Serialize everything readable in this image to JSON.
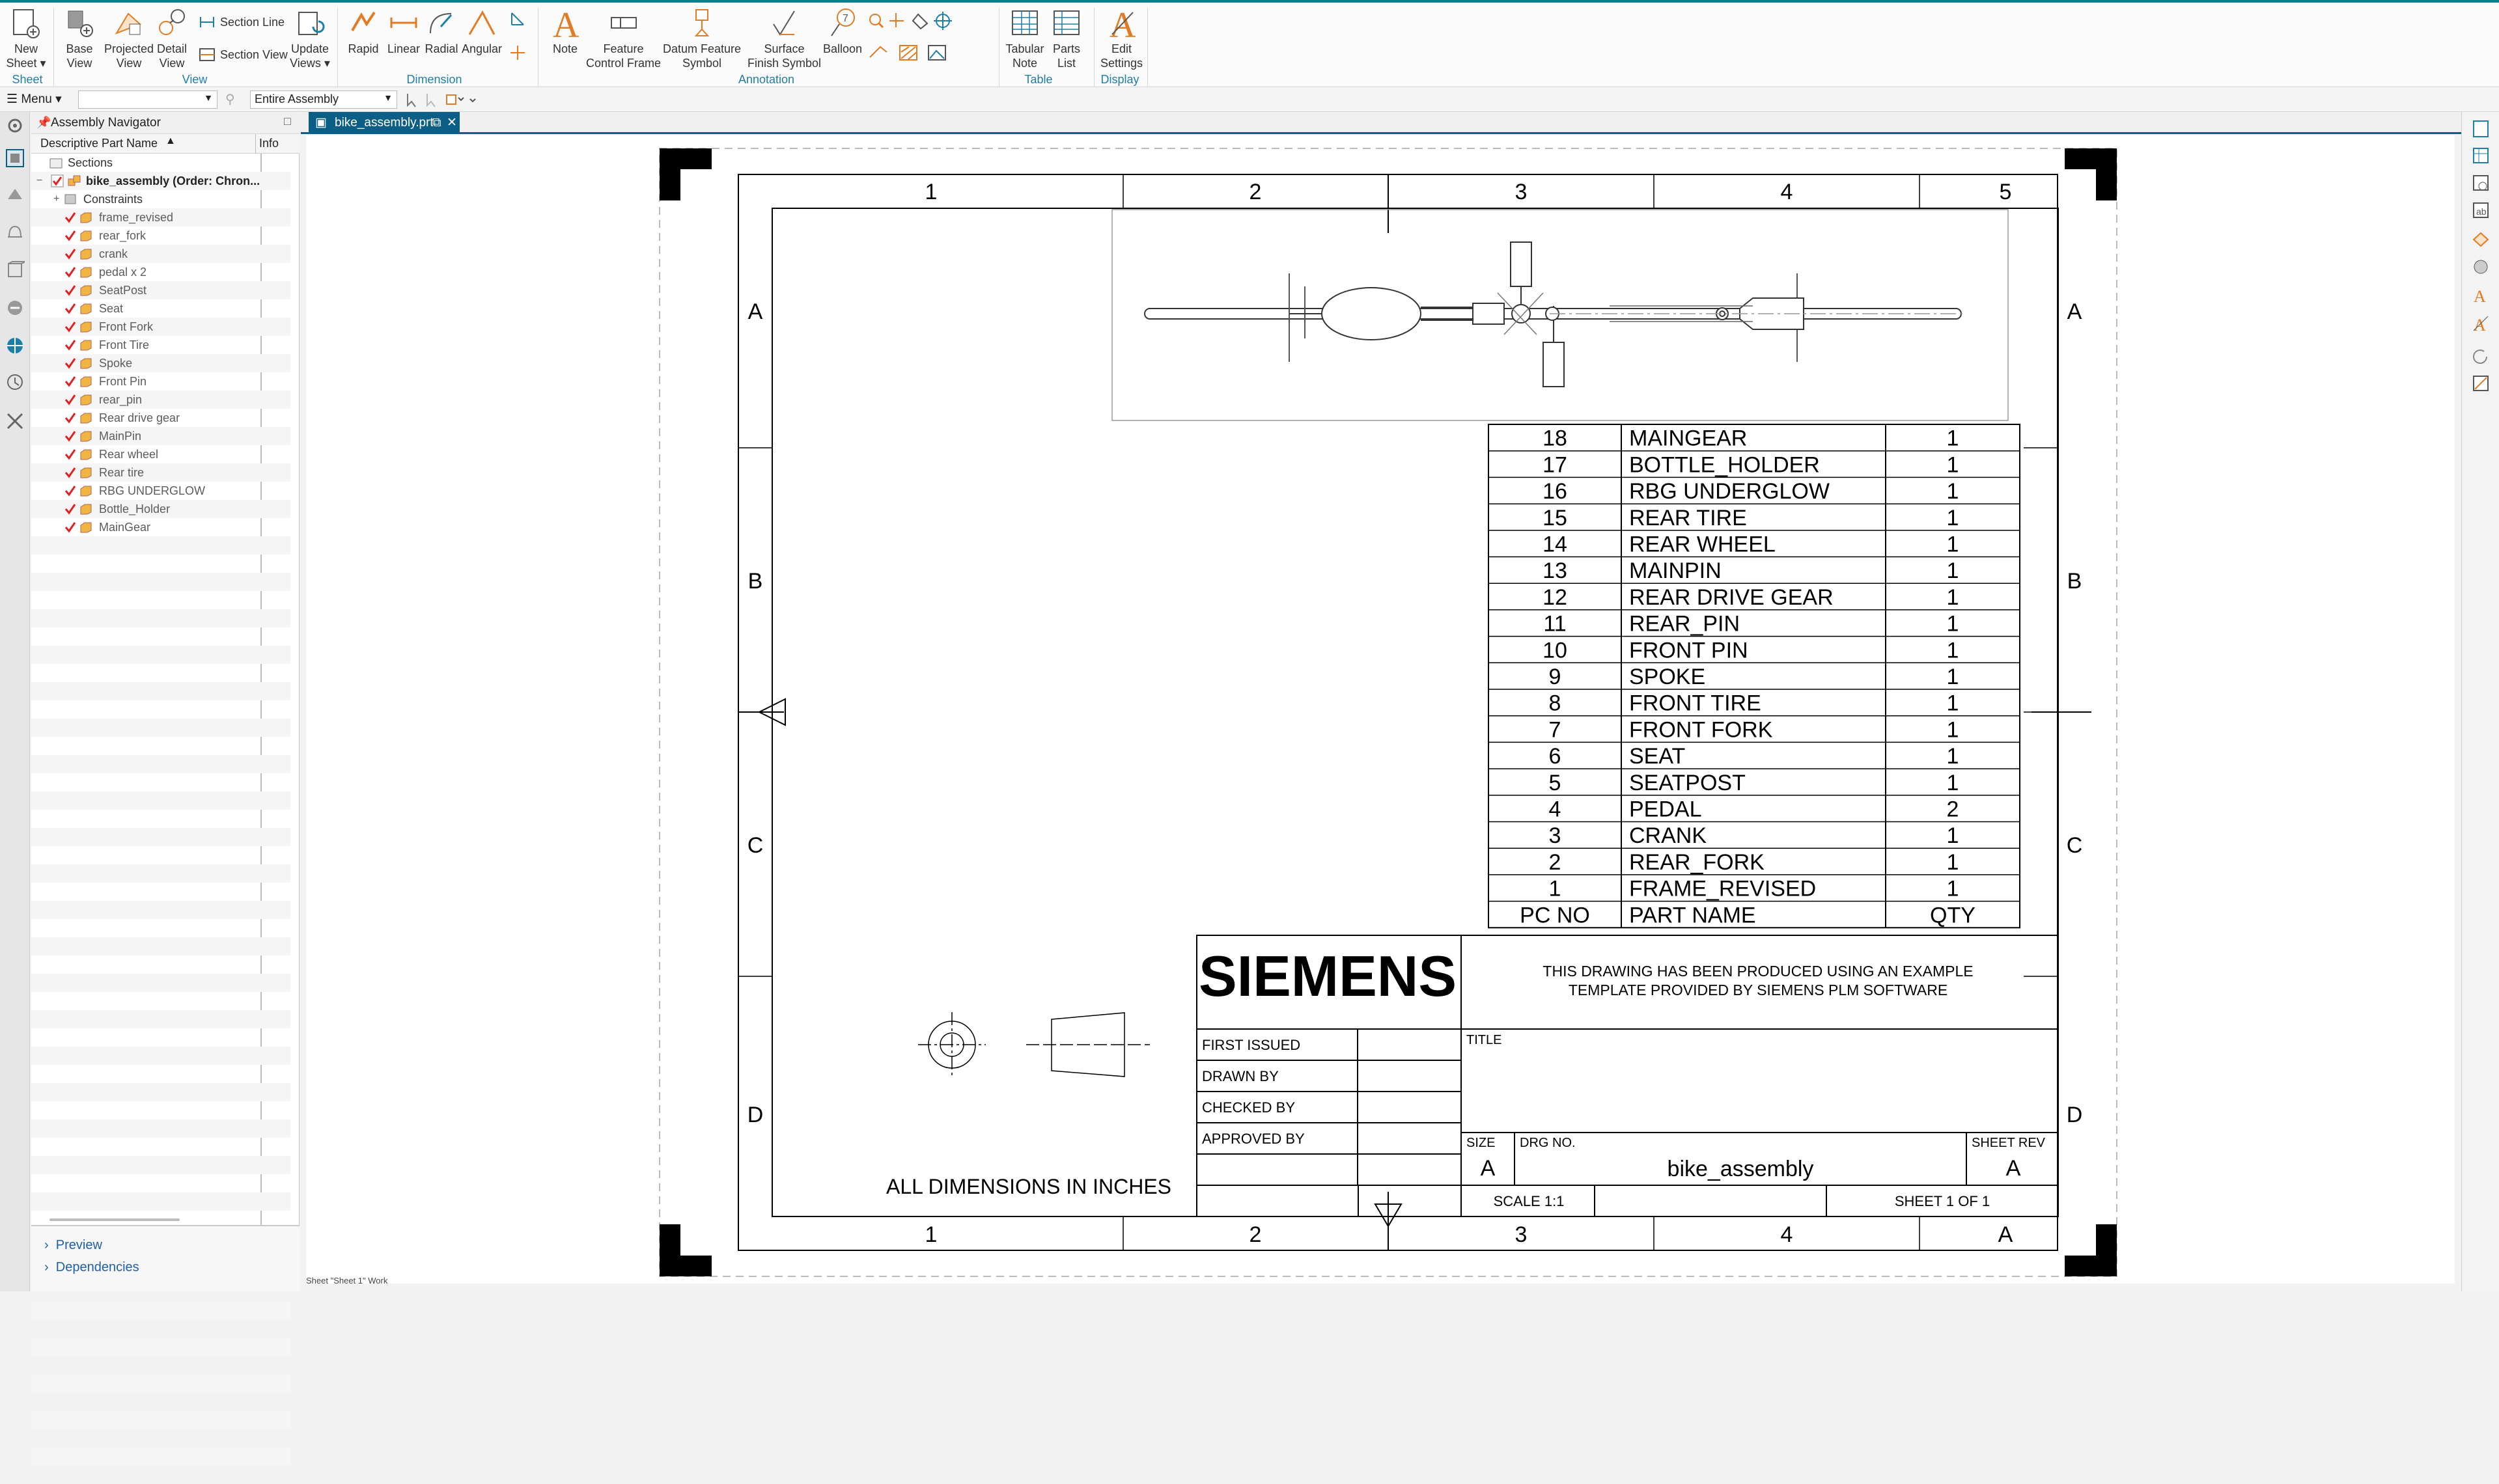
{
  "ribbon": {
    "buttons": [
      {
        "key": "new_sheet",
        "label": "New\nSheet ▾"
      },
      {
        "key": "base_view",
        "label": "Base\nView"
      },
      {
        "key": "projected_view",
        "label": "Projected\nView"
      },
      {
        "key": "detail_view",
        "label": "Detail\nView"
      },
      {
        "key": "update_views",
        "label": "Update\nViews ▾"
      },
      {
        "key": "rapid",
        "label": "Rapid"
      },
      {
        "key": "linear",
        "label": "Linear"
      },
      {
        "key": "radial",
        "label": "Radial"
      },
      {
        "key": "angular",
        "label": "Angular"
      },
      {
        "key": "note",
        "label": "Note"
      },
      {
        "key": "feature_control_frame",
        "label": "Feature\nControl Frame"
      },
      {
        "key": "datum_feature_symbol",
        "label": "Datum Feature\nSymbol"
      },
      {
        "key": "surface_finish_symbol",
        "label": "Surface\nFinish Symbol"
      },
      {
        "key": "balloon",
        "label": "Balloon"
      },
      {
        "key": "tabular_note",
        "label": "Tabular\nNote"
      },
      {
        "key": "parts_list",
        "label": "Parts\nList"
      },
      {
        "key": "edit_settings",
        "label": "Edit\nSettings"
      }
    ],
    "section_line": "Section Line",
    "section_view": "Section View",
    "groups": {
      "sheet": "Sheet",
      "view": "View",
      "dimension": "Dimension",
      "annotation": "Annotation",
      "table": "Table",
      "display": "Display"
    }
  },
  "quickbar": {
    "menu": "Menu ▾",
    "filter_value": "",
    "scope": "Entire Assembly"
  },
  "navigator": {
    "title": "Assembly Navigator",
    "col_name": "Descriptive Part Name",
    "col_info": "Info",
    "sections": "Sections",
    "root": "bike_assembly (Order: Chron...",
    "constraints": "Constraints",
    "parts": [
      "frame_revised",
      "rear_fork",
      "crank",
      "pedal x 2",
      "SeatPost",
      "Seat",
      "Front Fork",
      "Front Tire",
      "Spoke",
      "Front Pin",
      "rear_pin",
      "Rear drive gear",
      "MainPin",
      "Rear wheel",
      "Rear tire",
      "RBG UNDERGLOW",
      "Bottle_Holder",
      "MainGear"
    ],
    "preview": "Preview",
    "dependencies": "Dependencies"
  },
  "tab": {
    "label": "bike_assembly.prt"
  },
  "status": {
    "text": "Sheet \"Sheet 1\" Work"
  },
  "drawing": {
    "zone_cols": [
      "1",
      "2",
      "3",
      "4",
      "5"
    ],
    "zone_cols_bottom": [
      "1",
      "2",
      "3",
      "4",
      "A"
    ],
    "zone_rows": [
      "A",
      "B",
      "C",
      "D"
    ],
    "parts_list": {
      "headers": [
        "PC NO",
        "PART NAME",
        "QTY"
      ],
      "rows": [
        [
          "18",
          "MAINGEAR",
          "1"
        ],
        [
          "17",
          "BOTTLE_HOLDER",
          "1"
        ],
        [
          "16",
          "RBG UNDERGLOW",
          "1"
        ],
        [
          "15",
          "REAR TIRE",
          "1"
        ],
        [
          "14",
          "REAR WHEEL",
          "1"
        ],
        [
          "13",
          "MAINPIN",
          "1"
        ],
        [
          "12",
          "REAR DRIVE GEAR",
          "1"
        ],
        [
          "11",
          "REAR_PIN",
          "1"
        ],
        [
          "10",
          "FRONT PIN",
          "1"
        ],
        [
          "9",
          "SPOKE",
          "1"
        ],
        [
          "8",
          "FRONT TIRE",
          "1"
        ],
        [
          "7",
          "FRONT FORK",
          "1"
        ],
        [
          "6",
          "SEAT",
          "1"
        ],
        [
          "5",
          "SEATPOST",
          "1"
        ],
        [
          "4",
          "PEDAL",
          "2"
        ],
        [
          "3",
          "CRANK",
          "1"
        ],
        [
          "2",
          "REAR_FORK",
          "1"
        ],
        [
          "1",
          "FRAME_REVISED",
          "1"
        ]
      ]
    },
    "title_block": {
      "logo": "SIEMENS",
      "note_line1": "THIS DRAWING HAS BEEN PRODUCED USING AN EXAMPLE",
      "note_line2": "TEMPLATE PROVIDED BY SIEMENS PLM SOFTWARE",
      "first_issued": "FIRST ISSUED",
      "drawn_by": "DRAWN BY",
      "checked_by": "CHECKED BY",
      "approved_by": "APPROVED BY",
      "title_label": "TITLE",
      "size_label": "SIZE",
      "size_value": "A",
      "drg_label": "DRG NO.",
      "drg_value": "bike_assembly",
      "rev_label": "SHEET REV",
      "rev_value": "A",
      "scale": "SCALE 1:1",
      "sheet": "SHEET 1 OF 1"
    },
    "dimension_note": "ALL DIMENSIONS IN INCHES"
  }
}
